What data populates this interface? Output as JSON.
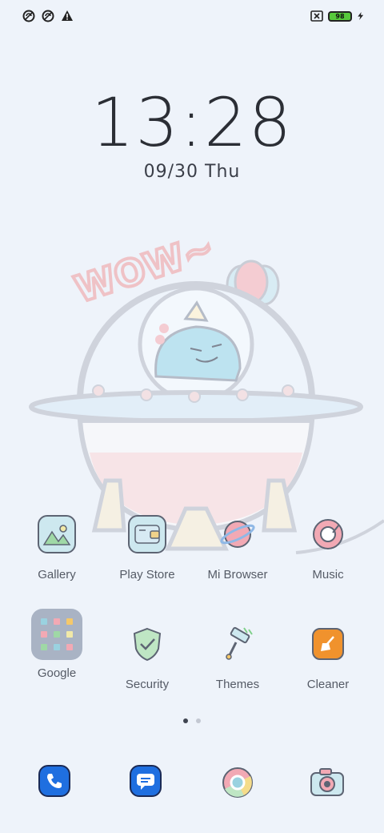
{
  "status_bar": {
    "left_icons": [
      "nfc-blocked-icon",
      "nfc-blocked-icon",
      "warning-icon"
    ],
    "battery_level": "98",
    "right_icons": [
      "sim-card-icon",
      "battery-icon",
      "charging-bolt-icon"
    ]
  },
  "clock": {
    "time": "13:28",
    "date_num": "09/30",
    "date_day": "Thu"
  },
  "wallpaper_text": "WOW~",
  "apps": [
    {
      "label": "Gallery",
      "icon": "gallery-icon"
    },
    {
      "label": "Play Store",
      "icon": "wallet-icon"
    },
    {
      "label": "Mi Browser",
      "icon": "planet-icon"
    },
    {
      "label": "Music",
      "icon": "music-disc-icon"
    },
    {
      "label": "Google",
      "icon": "folder-icon"
    },
    {
      "label": "Security",
      "icon": "shield-check-icon"
    },
    {
      "label": "Themes",
      "icon": "paint-roller-icon"
    },
    {
      "label": "Cleaner",
      "icon": "broom-icon"
    }
  ],
  "page_indicator": {
    "pages": 2,
    "current": 1
  },
  "dock": [
    {
      "icon": "phone-icon"
    },
    {
      "icon": "messages-icon"
    },
    {
      "icon": "chrome-icon"
    },
    {
      "icon": "camera-icon"
    }
  ],
  "colors": {
    "background": "#eef3fa",
    "battery": "#57c93b",
    "accent_blue": "#1f6fe0",
    "cleaner_orange": "#f0922d"
  }
}
